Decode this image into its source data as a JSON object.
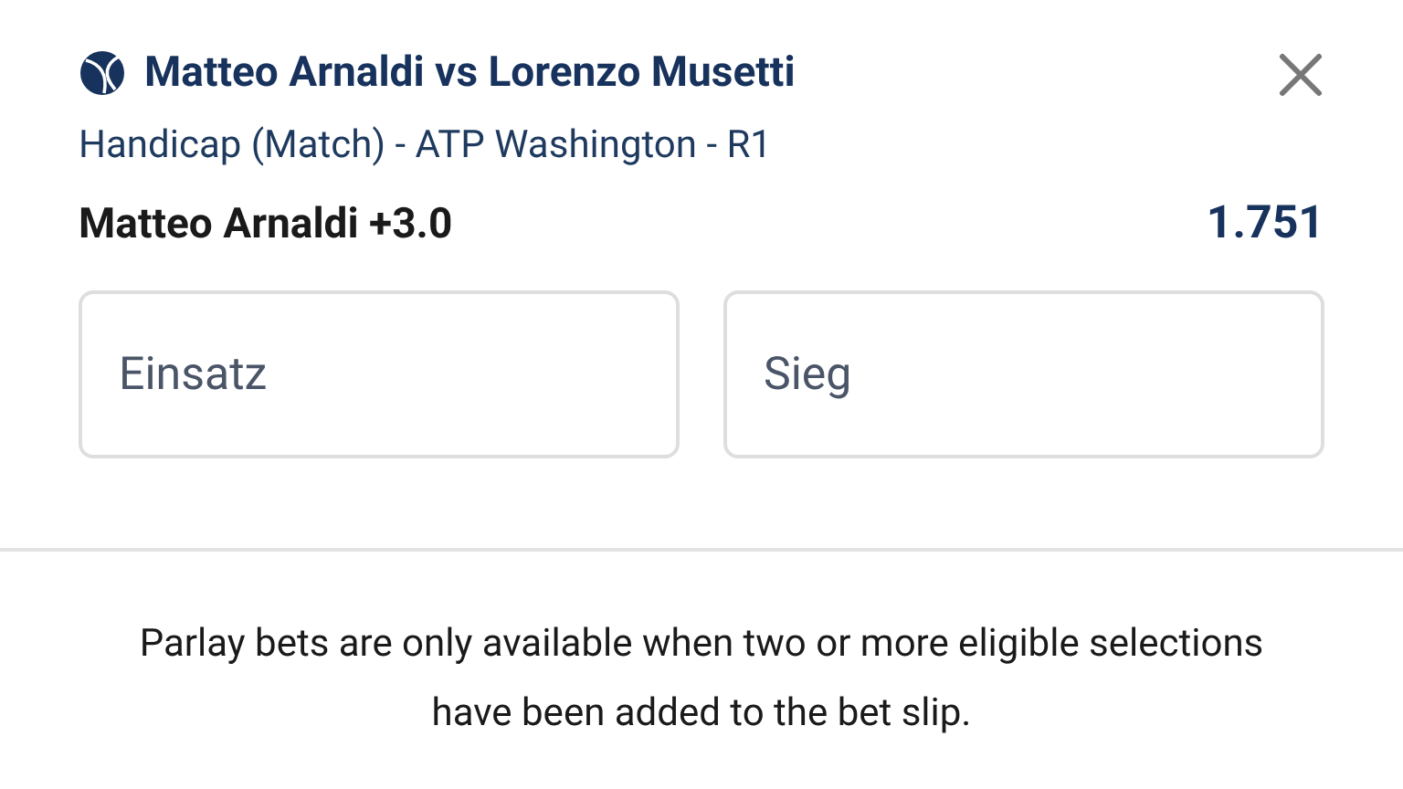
{
  "event": {
    "title": "Matteo Arnaldi vs Lorenzo Musetti",
    "market": "Handicap (Match) - ATP Washington - R1"
  },
  "selection": {
    "name": "Matteo Arnaldi +3.0",
    "odds": "1.751"
  },
  "fields": [
    {
      "placeholder": "Einsatz"
    },
    {
      "placeholder": "Sieg"
    }
  ],
  "notice": "Parlay bets are only available when two or more eligible selections have been added to the bet slip."
}
